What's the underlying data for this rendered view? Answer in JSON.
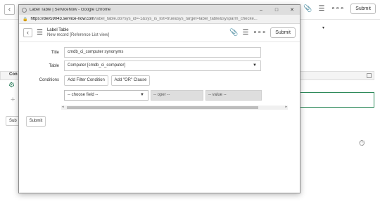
{
  "background": {
    "submit_label": "Submit",
    "related_list_label": "Con",
    "bottom_button_label": "Sub",
    "more_icon": "∘∘∘"
  },
  "popup": {
    "window_title": "Label Table | ServiceNow - Google Chrome",
    "minimize": "–",
    "maximize": "□",
    "close": "✕",
    "url_host": "https://dev59043.service-now.com",
    "url_path": "/label_table.do?sys_id=-1&sys_is_list=true&sys_target=label_table&sysparm_checke...",
    "form_title": "Label Table",
    "form_subtitle": "New record [Reference List view]",
    "submit_label": "Submit",
    "more_icon": "∘∘∘",
    "fields": {
      "title_label": "Title",
      "title_value": "cmdb_ci_computer synonyms",
      "table_label": "Table",
      "table_value": "Computer [cmdb_ci_computer]",
      "conditions_label": "Conditions"
    },
    "condition_builder": {
      "add_filter_label": "Add Filter Condition",
      "add_or_label": "Add \"OR\" Clause",
      "field_placeholder": "-- choose field --",
      "operator_placeholder": "-- oper --",
      "value_placeholder": "-- value --"
    },
    "bottom_submit_label": "Submit"
  }
}
